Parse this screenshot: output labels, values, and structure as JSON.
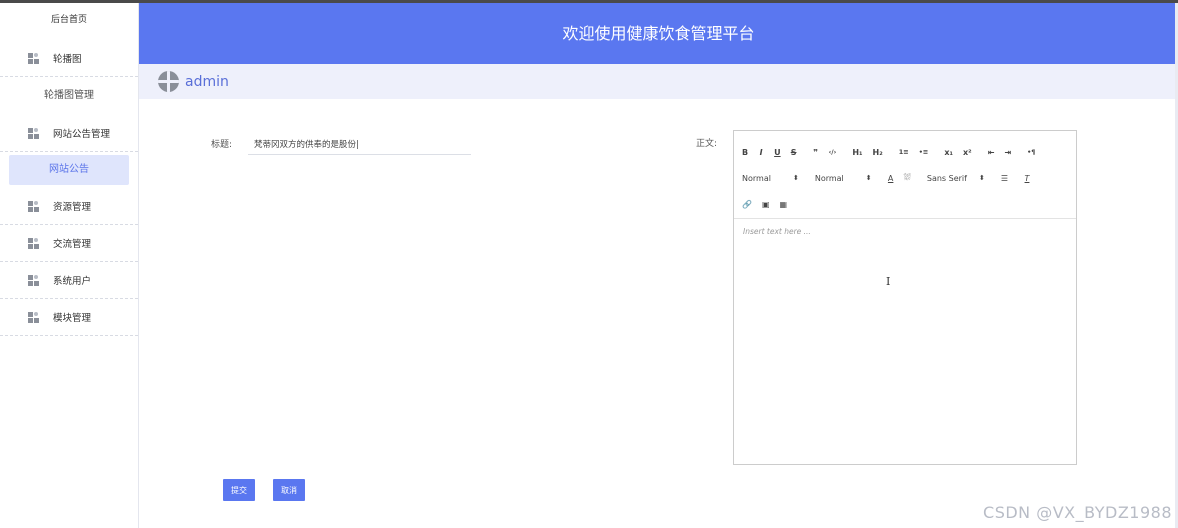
{
  "sidebar": {
    "home": "后台首页",
    "groups": [
      {
        "label": "轮播图",
        "icon": "grid-icon"
      },
      {
        "label": "网站公告管理",
        "icon": "grid-icon"
      },
      {
        "label": "资源管理",
        "icon": "grid-icon"
      },
      {
        "label": "交流管理",
        "icon": "grid-icon"
      },
      {
        "label": "系统用户",
        "icon": "grid-icon"
      },
      {
        "label": "模块管理",
        "icon": "grid-icon"
      }
    ],
    "subitems": {
      "carousel_manage": "轮播图管理",
      "notice": "网站公告"
    }
  },
  "header": {
    "title": "欢迎使用健康饮食管理平台"
  },
  "userbar": {
    "username": "admin"
  },
  "form": {
    "title_label": "标题:",
    "title_value": "梵蒂冈双方的供奉的是股份|",
    "body_label": "正文:",
    "editor": {
      "row1": [
        "B",
        "I",
        "U",
        "S",
        "❞",
        "‹/›",
        "H₁",
        "H₂",
        "1≡",
        "•≡",
        "x₁",
        "x²",
        "⇤",
        "⇥",
        "•¶"
      ],
      "font_size_select": "Normal",
      "header_select": "Normal",
      "font_family_select": "Sans Serif",
      "color_btn": "A",
      "placeholder": "Insert text here ..."
    },
    "submit_label": "提交",
    "cancel_label": "取消"
  },
  "watermark": "CSDN @VX_BYDZ1988",
  "colors": {
    "accent": "#5a77f0",
    "active_bg": "#dfe5fc",
    "userbar_bg": "#eef0fb"
  }
}
